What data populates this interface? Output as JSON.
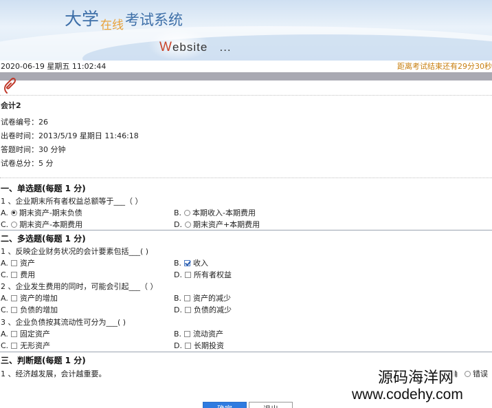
{
  "header": {
    "title_part1": "大学",
    "title_part2": "在线",
    "title_part3": "考试系统",
    "web_initial": "W",
    "web_rest": "ebsite",
    "web_ellipsis": "..."
  },
  "status": {
    "datetime": "2020-06-19 星期五 11:02:44",
    "countdown": "距离考试结束还有29分30秒"
  },
  "paper": {
    "name": "会计2",
    "number": "试卷编号：26",
    "created": "出卷时间：2013/5/19 星期日 11:46:18",
    "duration": "答题时间：30 分钟",
    "total_score": "试卷总分：5 分"
  },
  "sections": {
    "single": {
      "heading": "一、单选题(每题 1 分)",
      "questions": [
        {
          "text": "1 、企业期末所有者权益总额等于___（  ）",
          "options": [
            {
              "label": "A.",
              "text": "期末资产-期末负债",
              "selected": true
            },
            {
              "label": "B.",
              "text": "本期收入-本期费用",
              "selected": false
            },
            {
              "label": "C.",
              "text": "期末资产-本期费用",
              "selected": false
            },
            {
              "label": "D.",
              "text": "期末资产+本期费用",
              "selected": false
            }
          ]
        }
      ]
    },
    "multiple": {
      "heading": "二、多选题(每题 1 分)",
      "questions": [
        {
          "text": "1 、反映企业财务状况的会计要素包括___( )",
          "options": [
            {
              "label": "A.",
              "text": "资产",
              "checked": false
            },
            {
              "label": "B.",
              "text": "收入",
              "checked": true
            },
            {
              "label": "C.",
              "text": "费用",
              "checked": false
            },
            {
              "label": "D.",
              "text": "所有者权益",
              "checked": false
            }
          ]
        },
        {
          "text": "2 、企业发生费用的同时，可能会引起___（      ）",
          "options": [
            {
              "label": "A.",
              "text": "资产的增加",
              "checked": false
            },
            {
              "label": "B.",
              "text": "资产的减少",
              "checked": false
            },
            {
              "label": "C.",
              "text": "负债的增加",
              "checked": false
            },
            {
              "label": "D.",
              "text": "负债的减少",
              "checked": false
            }
          ]
        },
        {
          "text": "3 、企业负债按其流动性可分为___( )",
          "options": [
            {
              "label": "A.",
              "text": "固定资产",
              "checked": false
            },
            {
              "label": "B.",
              "text": "流动资产",
              "checked": false
            },
            {
              "label": "C.",
              "text": "无形资产",
              "checked": false
            },
            {
              "label": "D.",
              "text": "长期投资",
              "checked": false
            }
          ]
        }
      ]
    },
    "judge": {
      "heading": "三、判断题(每题 1 分)",
      "questions": [
        {
          "text": "1 、经济越发展，会计越重要。",
          "options": [
            {
              "text": "正确",
              "selected": false
            },
            {
              "text": "错误",
              "selected": false
            }
          ]
        }
      ]
    }
  },
  "watermark": {
    "line1": "源码海洋网",
    "line2": "www.codehy.com"
  },
  "buttons": {
    "submit": "确定",
    "exit": "退出"
  }
}
